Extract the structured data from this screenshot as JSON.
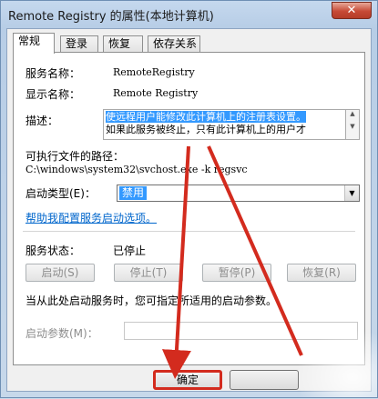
{
  "window": {
    "title": "Remote Registry 的属性(本地计算机)",
    "close_glyph": "✕"
  },
  "tabs": [
    {
      "label": "常规"
    },
    {
      "label": "登录"
    },
    {
      "label": "恢复"
    },
    {
      "label": "依存关系"
    }
  ],
  "general": {
    "service_name_label": "服务名称：",
    "service_name_value": "RemoteRegistry",
    "display_name_label": "显示名称：",
    "display_name_value": "Remote Registry",
    "description_label": "描述：",
    "description_line1": "使远程用户能修改此计算机上的注册表设置。",
    "description_line2": "如果此服务被终止，只有此计算机上的用户才",
    "exe_path_label": "可执行文件的路径：",
    "exe_path_value": "C:\\windows\\system32\\svchost.exe -k regsvc",
    "startup_type_label": "启动类型(E)：",
    "startup_type_value": "禁用",
    "help_link": "帮助我配置服务启动选项。",
    "status_label": "服务状态：",
    "status_value": "已停止",
    "buttons": {
      "start": "启动(S)",
      "stop": "停止(T)",
      "pause": "暂停(P)",
      "resume": "恢复(R)"
    },
    "start_hint": "当从此处启动服务时，您可指定所适用的启动参数。",
    "start_params_label": "启动参数(M)：",
    "start_params_value": ""
  },
  "footer": {
    "ok": "确定",
    "cancel": ""
  },
  "colors": {
    "annotation_red": "#d32b1e",
    "selection_blue": "#3399ff",
    "link_blue": "#0066cc"
  }
}
